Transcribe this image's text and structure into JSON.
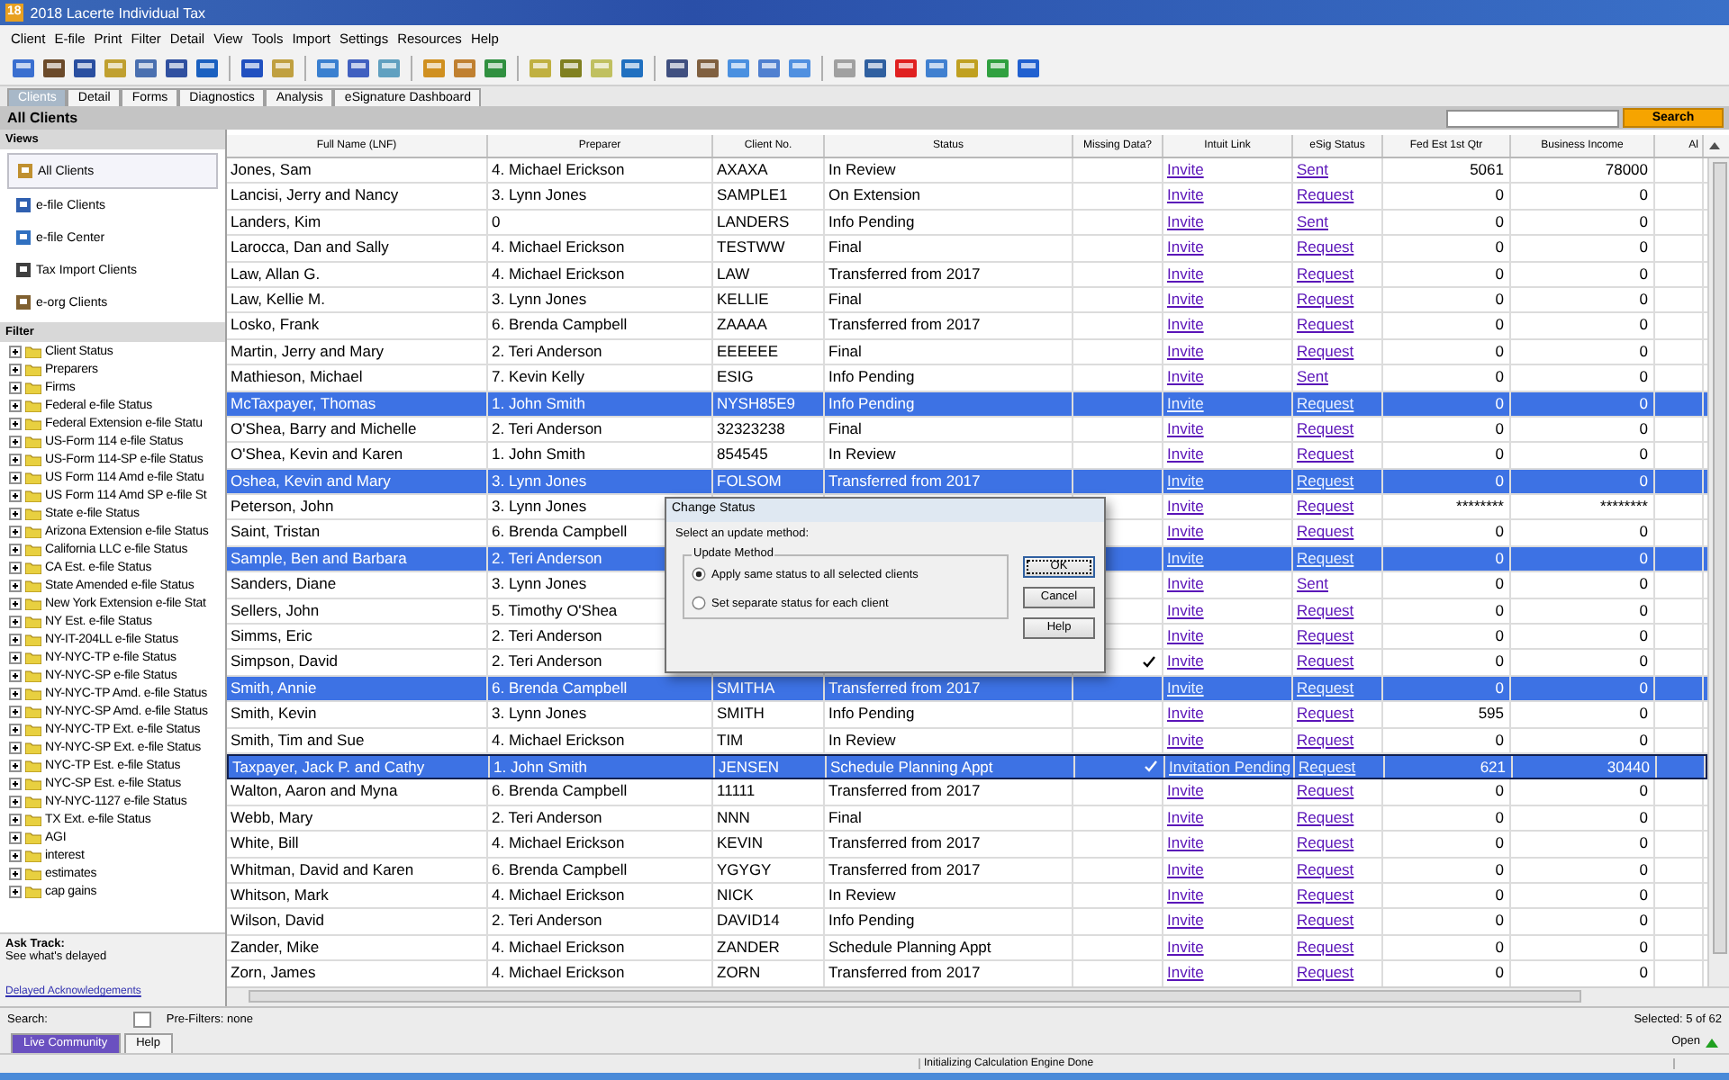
{
  "window": {
    "app_icon": "18",
    "title": "2018 Lacerte Individual Tax"
  },
  "menu": [
    "Client",
    "E-file",
    "Print",
    "Filter",
    "Detail",
    "View",
    "Tools",
    "Import",
    "Settings",
    "Resources",
    "Help"
  ],
  "tabs": [
    {
      "label": "Clients",
      "selected": true
    },
    {
      "label": "Detail",
      "selected": false
    },
    {
      "label": "Forms",
      "selected": false
    },
    {
      "label": "Diagnostics",
      "selected": false
    },
    {
      "label": "Analysis",
      "selected": false
    },
    {
      "label": "eSignature Dashboard",
      "selected": false
    }
  ],
  "view_title": "All Clients",
  "search_button": "Search",
  "sidebar": {
    "views_heading": "Views",
    "views": [
      {
        "label": "All Clients",
        "selected": true
      },
      {
        "label": "e-file Clients",
        "selected": false
      },
      {
        "label": "e-file Center",
        "selected": false
      },
      {
        "label": "Tax Import Clients",
        "selected": false
      },
      {
        "label": "e-org Clients",
        "selected": false
      }
    ],
    "filter_heading": "Filter",
    "filters": [
      {
        "label": "Client Status",
        "expanded": false
      },
      {
        "label": "Preparers",
        "expanded": false
      },
      {
        "label": "Firms",
        "expanded": false
      },
      {
        "label": "Federal e-file Status",
        "expanded": false
      },
      {
        "label": "Federal Extension e-file Statu",
        "expanded": false
      },
      {
        "label": "US-Form 114 e-file Status",
        "expanded": false
      },
      {
        "label": "US-Form 114-SP e-file Status",
        "expanded": false
      },
      {
        "label": "US Form 114 Amd e-file Statu",
        "expanded": false
      },
      {
        "label": "US Form 114 Amd SP e-file St",
        "expanded": false
      },
      {
        "label": "State e-file Status",
        "expanded": false
      },
      {
        "label": "Arizona Extension e-file Status",
        "expanded": false
      },
      {
        "label": "California LLC e-file Status",
        "expanded": false
      },
      {
        "label": "CA Est. e-file Status",
        "expanded": false
      },
      {
        "label": "State Amended e-file Status",
        "expanded": false
      },
      {
        "label": "New York Extension e-file Stat",
        "expanded": false
      },
      {
        "label": "NY Est. e-file Status",
        "expanded": false
      },
      {
        "label": "NY-IT-204LL e-file Status",
        "expanded": false
      },
      {
        "label": "NY-NYC-TP e-file Status",
        "expanded": false
      },
      {
        "label": "NY-NYC-SP e-file Status",
        "expanded": false
      },
      {
        "label": "NY-NYC-TP Amd. e-file Status",
        "expanded": false
      },
      {
        "label": "NY-NYC-SP Amd. e-file Status",
        "expanded": false
      },
      {
        "label": "NY-NYC-TP Ext. e-file Status",
        "expanded": false
      },
      {
        "label": "NY-NYC-SP Ext. e-file Status",
        "expanded": false
      },
      {
        "label": "NYC-TP Est. e-file Status",
        "expanded": false
      },
      {
        "label": "NYC-SP Est. e-file Status",
        "expanded": false
      },
      {
        "label": "NY-NYC-1127 e-file Status",
        "expanded": false
      },
      {
        "label": "TX Ext. e-file Status",
        "expanded": false
      },
      {
        "label": "AGI",
        "expanded": false
      },
      {
        "label": "interest",
        "expanded": false
      },
      {
        "label": "estimates",
        "expanded": false
      },
      {
        "label": "cap gains",
        "expanded": false
      }
    ],
    "ask_track": {
      "title": "Ask Track:",
      "text": "See what's delayed",
      "link": "Delayed Acknowledgements"
    }
  },
  "table": {
    "columns": [
      "Full Name (LNF)",
      "Preparer",
      "Client No.",
      "Status",
      "Missing Data?",
      "Intuit Link",
      "eSig Status",
      "Fed Est 1st Qtr",
      "Business Income",
      "Al"
    ],
    "rows": [
      {
        "name": "Jones, Sam",
        "preparer": "4. Michael Erickson",
        "client_no": "AXAXA",
        "status": "In Review",
        "missing_data": false,
        "link": "Invite",
        "esig": "Sent",
        "fed": "5061",
        "income": "78000",
        "selected": false,
        "focused": false
      },
      {
        "name": "Lancisi, Jerry and Nancy",
        "preparer": "3. Lynn Jones",
        "client_no": "SAMPLE1",
        "status": "On Extension",
        "missing_data": false,
        "link": "Invite",
        "esig": "Request",
        "fed": "0",
        "income": "0",
        "selected": false,
        "focused": false
      },
      {
        "name": "Landers, Kim",
        "preparer": "0",
        "client_no": "LANDERS",
        "status": "Info Pending",
        "missing_data": false,
        "link": "Invite",
        "esig": "Sent",
        "fed": "0",
        "income": "0",
        "selected": false,
        "focused": false
      },
      {
        "name": "Larocca, Dan and Sally",
        "preparer": "4. Michael Erickson",
        "client_no": "TESTWW",
        "status": "Final",
        "missing_data": false,
        "link": "Invite",
        "esig": "Request",
        "fed": "0",
        "income": "0",
        "selected": false,
        "focused": false
      },
      {
        "name": "Law, Allan G.",
        "preparer": "4. Michael Erickson",
        "client_no": "LAW",
        "status": "Transferred from 2017",
        "missing_data": false,
        "link": "Invite",
        "esig": "Request",
        "fed": "0",
        "income": "0",
        "selected": false,
        "focused": false
      },
      {
        "name": "Law, Kellie M.",
        "preparer": "3. Lynn Jones",
        "client_no": "KELLIE",
        "status": "Final",
        "missing_data": false,
        "link": "Invite",
        "esig": "Request",
        "fed": "0",
        "income": "0",
        "selected": false,
        "focused": false
      },
      {
        "name": "Losko, Frank",
        "preparer": "6. Brenda Campbell",
        "client_no": "ZAAAA",
        "status": "Transferred from 2017",
        "missing_data": false,
        "link": "Invite",
        "esig": "Request",
        "fed": "0",
        "income": "0",
        "selected": false,
        "focused": false
      },
      {
        "name": "Martin, Jerry and Mary",
        "preparer": "2. Teri Anderson",
        "client_no": "EEEEEE",
        "status": "Final",
        "missing_data": false,
        "link": "Invite",
        "esig": "Request",
        "fed": "0",
        "income": "0",
        "selected": false,
        "focused": false
      },
      {
        "name": "Mathieson, Michael",
        "preparer": "7. Kevin Kelly",
        "client_no": "ESIG",
        "status": "Info Pending",
        "missing_data": false,
        "link": "Invite",
        "esig": "Sent",
        "fed": "0",
        "income": "0",
        "selected": false,
        "focused": false
      },
      {
        "name": "McTaxpayer, Thomas",
        "preparer": "1. John Smith",
        "client_no": "NYSH85E9",
        "status": "Info Pending",
        "missing_data": false,
        "link": "Invite",
        "esig": "Request",
        "fed": "0",
        "income": "0",
        "selected": true,
        "focused": false
      },
      {
        "name": "O'Shea, Barry and Michelle",
        "preparer": "2. Teri Anderson",
        "client_no": "32323238",
        "status": "Final",
        "missing_data": false,
        "link": "Invite",
        "esig": "Request",
        "fed": "0",
        "income": "0",
        "selected": false,
        "focused": false
      },
      {
        "name": "O'Shea, Kevin and Karen",
        "preparer": "1. John Smith",
        "client_no": "854545",
        "status": "In Review",
        "missing_data": false,
        "link": "Invite",
        "esig": "Request",
        "fed": "0",
        "income": "0",
        "selected": false,
        "focused": false
      },
      {
        "name": "Oshea, Kevin and Mary",
        "preparer": "3. Lynn Jones",
        "client_no": "FOLSOM",
        "status": "Transferred from 2017",
        "missing_data": false,
        "link": "Invite",
        "esig": "Request",
        "fed": "0",
        "income": "0",
        "selected": true,
        "focused": false
      },
      {
        "name": "Peterson, John",
        "preparer": "3. Lynn Jones",
        "missing_data": false,
        "link": "Invite",
        "esig": "Request",
        "fed": "********",
        "income": "********",
        "selected": false,
        "focused": false
      },
      {
        "name": "Saint, Tristan",
        "preparer": "6. Brenda Campbell",
        "missing_data": false,
        "link": "Invite",
        "esig": "Request",
        "fed": "0",
        "income": "0",
        "selected": false,
        "focused": false
      },
      {
        "name": "Sample, Ben and Barbara",
        "preparer": "2. Teri Anderson",
        "missing_data": false,
        "link": "Invite",
        "esig": "Request",
        "fed": "0",
        "income": "0",
        "selected": true,
        "focused": false
      },
      {
        "name": "Sanders, Diane",
        "preparer": "3. Lynn Jones",
        "missing_data": false,
        "link": "Invite",
        "esig": "Sent",
        "fed": "0",
        "income": "0",
        "selected": false,
        "focused": false
      },
      {
        "name": "Sellers, John",
        "preparer": "5. Timothy O'Shea",
        "missing_data": false,
        "link": "Invite",
        "esig": "Request",
        "fed": "0",
        "income": "0",
        "selected": false,
        "focused": false
      },
      {
        "name": "Simms, Eric",
        "preparer": "2. Teri Anderson",
        "missing_data": false,
        "link": "Invite",
        "esig": "Request",
        "fed": "0",
        "income": "0",
        "selected": false,
        "focused": false
      },
      {
        "name": "Simpson, David",
        "preparer": "2. Teri Anderson",
        "missing_data": true,
        "link": "Invite",
        "esig": "Request",
        "fed": "0",
        "income": "0",
        "selected": false,
        "focused": false
      },
      {
        "name": "Smith, Annie",
        "preparer": "6. Brenda Campbell",
        "client_no": "SMITHA",
        "status": "Transferred from 2017",
        "missing_data": false,
        "link": "Invite",
        "esig": "Request",
        "fed": "0",
        "income": "0",
        "selected": true,
        "focused": false
      },
      {
        "name": "Smith, Kevin",
        "preparer": "3. Lynn Jones",
        "client_no": "SMITH",
        "status": "Info Pending",
        "missing_data": false,
        "link": "Invite",
        "esig": "Request",
        "fed": "595",
        "income": "0",
        "selected": false,
        "focused": false
      },
      {
        "name": "Smith, Tim and Sue",
        "preparer": "4. Michael Erickson",
        "client_no": "TIM",
        "status": "In Review",
        "missing_data": false,
        "link": "Invite",
        "esig": "Request",
        "fed": "0",
        "income": "0",
        "selected": false,
        "focused": false
      },
      {
        "name": "Taxpayer, Jack P. and Cathy",
        "preparer": "1. John Smith",
        "client_no": "JENSEN",
        "status": "Schedule Planning Appt",
        "missing_data": true,
        "link": "Invitation Pending",
        "esig": "Request",
        "fed": "621",
        "income": "30440",
        "selected": true,
        "focused": true
      },
      {
        "name": "Walton, Aaron and Myna",
        "preparer": "6. Brenda Campbell",
        "client_no": "11111",
        "status": "Transferred from 2017",
        "missing_data": false,
        "link": "Invite",
        "esig": "Request",
        "fed": "0",
        "income": "0",
        "selected": false,
        "focused": false
      },
      {
        "name": "Webb, Mary",
        "preparer": "2. Teri Anderson",
        "client_no": "NNN",
        "status": "Final",
        "missing_data": false,
        "link": "Invite",
        "esig": "Request",
        "fed": "0",
        "income": "0",
        "selected": false,
        "focused": false
      },
      {
        "name": "White, Bill",
        "preparer": "4. Michael Erickson",
        "client_no": "KEVIN",
        "status": "Transferred from 2017",
        "missing_data": false,
        "link": "Invite",
        "esig": "Request",
        "fed": "0",
        "income": "0",
        "selected": false,
        "focused": false
      },
      {
        "name": "Whitman, David and Karen",
        "preparer": "6. Brenda Campbell",
        "client_no": "YGYGY",
        "status": "Transferred from 2017",
        "missing_data": false,
        "link": "Invite",
        "esig": "Request",
        "fed": "0",
        "income": "0",
        "selected": false,
        "focused": false
      },
      {
        "name": "Whitson, Mark",
        "preparer": "4. Michael Erickson",
        "client_no": "NICK",
        "status": "In Review",
        "missing_data": false,
        "link": "Invite",
        "esig": "Request",
        "fed": "0",
        "income": "0",
        "selected": false,
        "focused": false
      },
      {
        "name": "Wilson, David",
        "preparer": "2. Teri Anderson",
        "client_no": "DAVID14",
        "status": "Info Pending",
        "missing_data": false,
        "link": "Invite",
        "esig": "Request",
        "fed": "0",
        "income": "0",
        "selected": false,
        "focused": false
      },
      {
        "name": "Zander, Mike",
        "preparer": "4. Michael Erickson",
        "client_no": "ZANDER",
        "status": "Schedule Planning Appt",
        "missing_data": false,
        "link": "Invite",
        "esig": "Request",
        "fed": "0",
        "income": "0",
        "selected": false,
        "focused": false
      },
      {
        "name": "Zorn, James",
        "preparer": "4. Michael Erickson",
        "client_no": "ZORN",
        "status": "Transferred from 2017",
        "missing_data": false,
        "link": "Invite",
        "esig": "Request",
        "fed": "0",
        "income": "0",
        "selected": false,
        "focused": false
      }
    ]
  },
  "dialog": {
    "title": "Change Status",
    "prompt": "Select an update method:",
    "group": "Update Method",
    "options": [
      {
        "label": "Apply same status to all selected clients",
        "selected": true
      },
      {
        "label": "Set separate status for each client",
        "selected": false
      }
    ],
    "buttons": [
      {
        "label": "OK",
        "focused": true
      },
      {
        "label": "Cancel",
        "focused": false
      },
      {
        "label": "Help",
        "focused": false
      }
    ]
  },
  "footer": {
    "search_label": "Search:",
    "pre_filters": "Pre-Filters: none",
    "selected_count": "Selected: 5 of 62",
    "bottom_tabs": [
      {
        "label": "Live Community",
        "selected": true
      },
      {
        "label": "Help",
        "selected": false
      }
    ],
    "open": "Open",
    "status": "Initializing Calculation Engine Done"
  }
}
